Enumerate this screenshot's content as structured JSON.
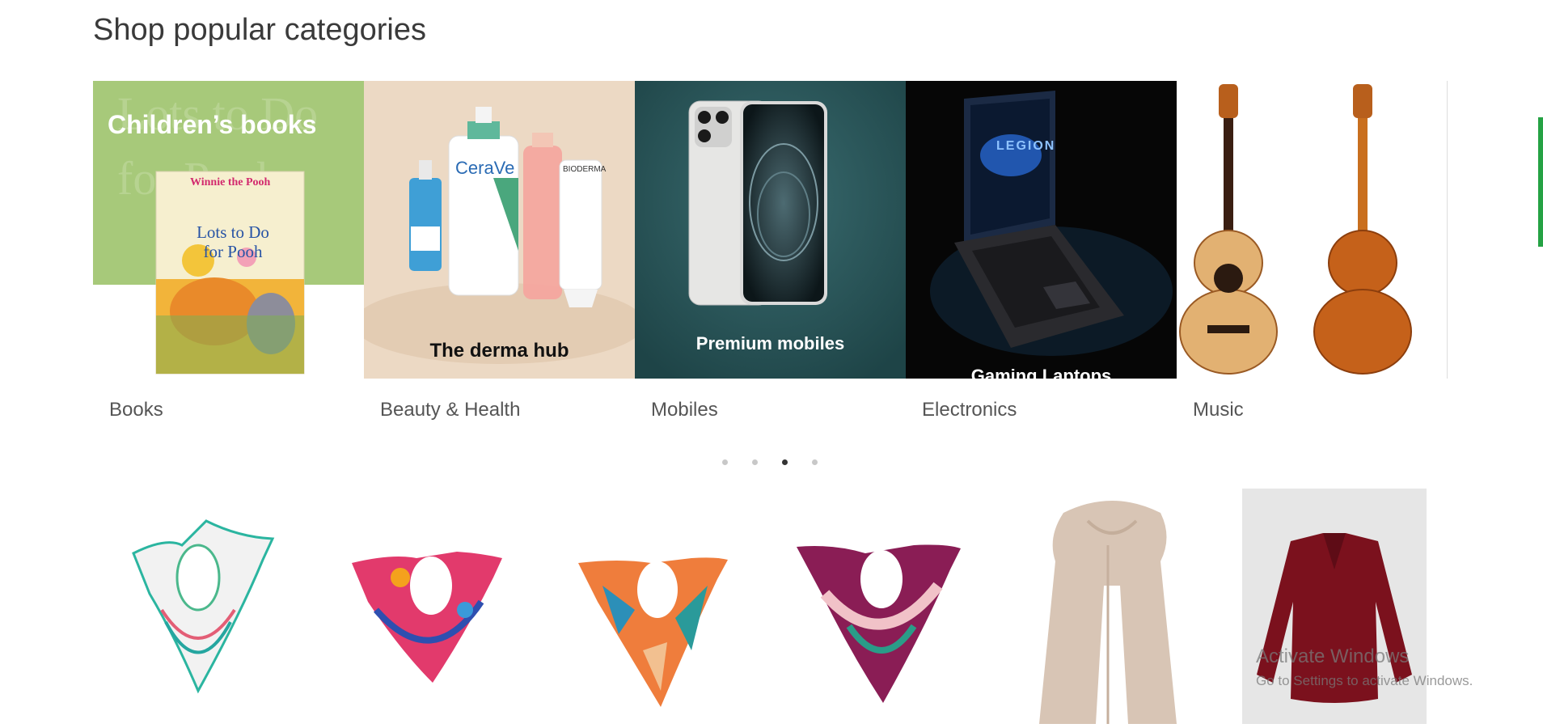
{
  "page": {
    "title": "Shop popular categories"
  },
  "categories": [
    {
      "label": "Books",
      "banner": "Children’s books",
      "book_title": "Lots to Do for Pooh",
      "book_brand": "Winnie the Pooh"
    },
    {
      "label": "Beauty & Health",
      "banner": "The derma hub",
      "brand_1": "CeraVe",
      "brand_2": "BIODERMA"
    },
    {
      "label": "Mobiles",
      "banner": "Premium mobiles"
    },
    {
      "label": "Electronics",
      "banner": "Gaming Laptops",
      "screen_text": "LEGION"
    },
    {
      "label": "Music",
      "banner": ""
    }
  ],
  "pagination": {
    "count": 4,
    "active_index": 2
  },
  "products": [
    {
      "name": "white-floral-silk-scarf"
    },
    {
      "name": "pink-blue-floral-silk-scarf"
    },
    {
      "name": "orange-teal-geometric-silk-scarf"
    },
    {
      "name": "magenta-leaf-silk-scarf"
    },
    {
      "name": "beige-long-scarf"
    },
    {
      "name": "burgundy-blouse"
    }
  ],
  "os_watermark": {
    "title": "Activate Windows",
    "subtitle": "Go to Settings to activate Windows."
  },
  "colors": {
    "books_bg": "#a7c97a",
    "beauty_bg": "#ecd9c4",
    "mobiles_bg": "#2a5559",
    "electronics_bg": "#060606",
    "blouse_bg": "#e6e6e6",
    "accent_green": "#25a244"
  }
}
